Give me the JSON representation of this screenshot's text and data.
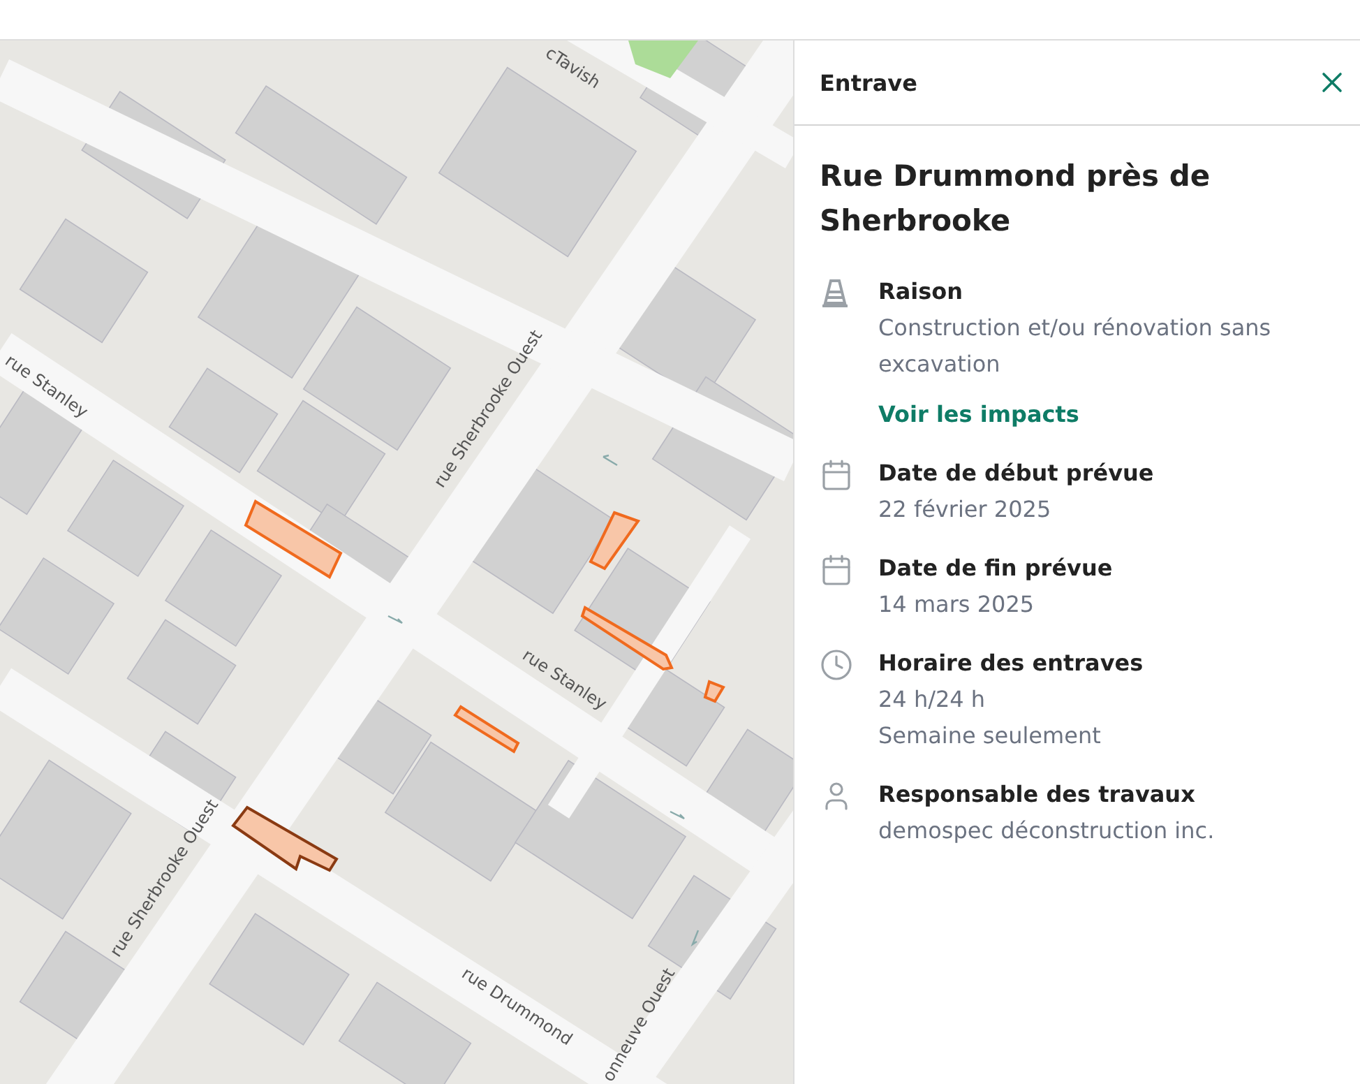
{
  "map": {
    "street_labels": [
      "cTavish",
      "rue Stanley",
      "rue Sherbrooke Ouest",
      "rue Stanley",
      "rue Sherbrooke Ouest",
      "rue Drummond",
      "onneuve Ouest"
    ],
    "closures": [
      {
        "selected": false
      },
      {
        "selected": false
      },
      {
        "selected": false
      },
      {
        "selected": false
      },
      {
        "selected": false
      },
      {
        "selected": true
      }
    ]
  },
  "panel": {
    "header": "Entrave",
    "title": "Rue Drummond près de Sherbrooke",
    "details": [
      {
        "kind": "reason",
        "label": "Raison",
        "values": [
          "Construction et/ou rénovation sans excavation"
        ],
        "link": "Voir les impacts"
      },
      {
        "kind": "date",
        "label": "Date de début prévue",
        "values": [
          "22 février 2025"
        ]
      },
      {
        "kind": "date",
        "label": "Date de fin prévue",
        "values": [
          "14 mars 2025"
        ]
      },
      {
        "kind": "schedule",
        "label": "Horaire des entraves",
        "values": [
          "24 h/24 h",
          "Semaine seulement"
        ]
      },
      {
        "kind": "person",
        "label": "Responsable des travaux",
        "values": [
          "demospec déconstruction inc."
        ]
      }
    ]
  }
}
